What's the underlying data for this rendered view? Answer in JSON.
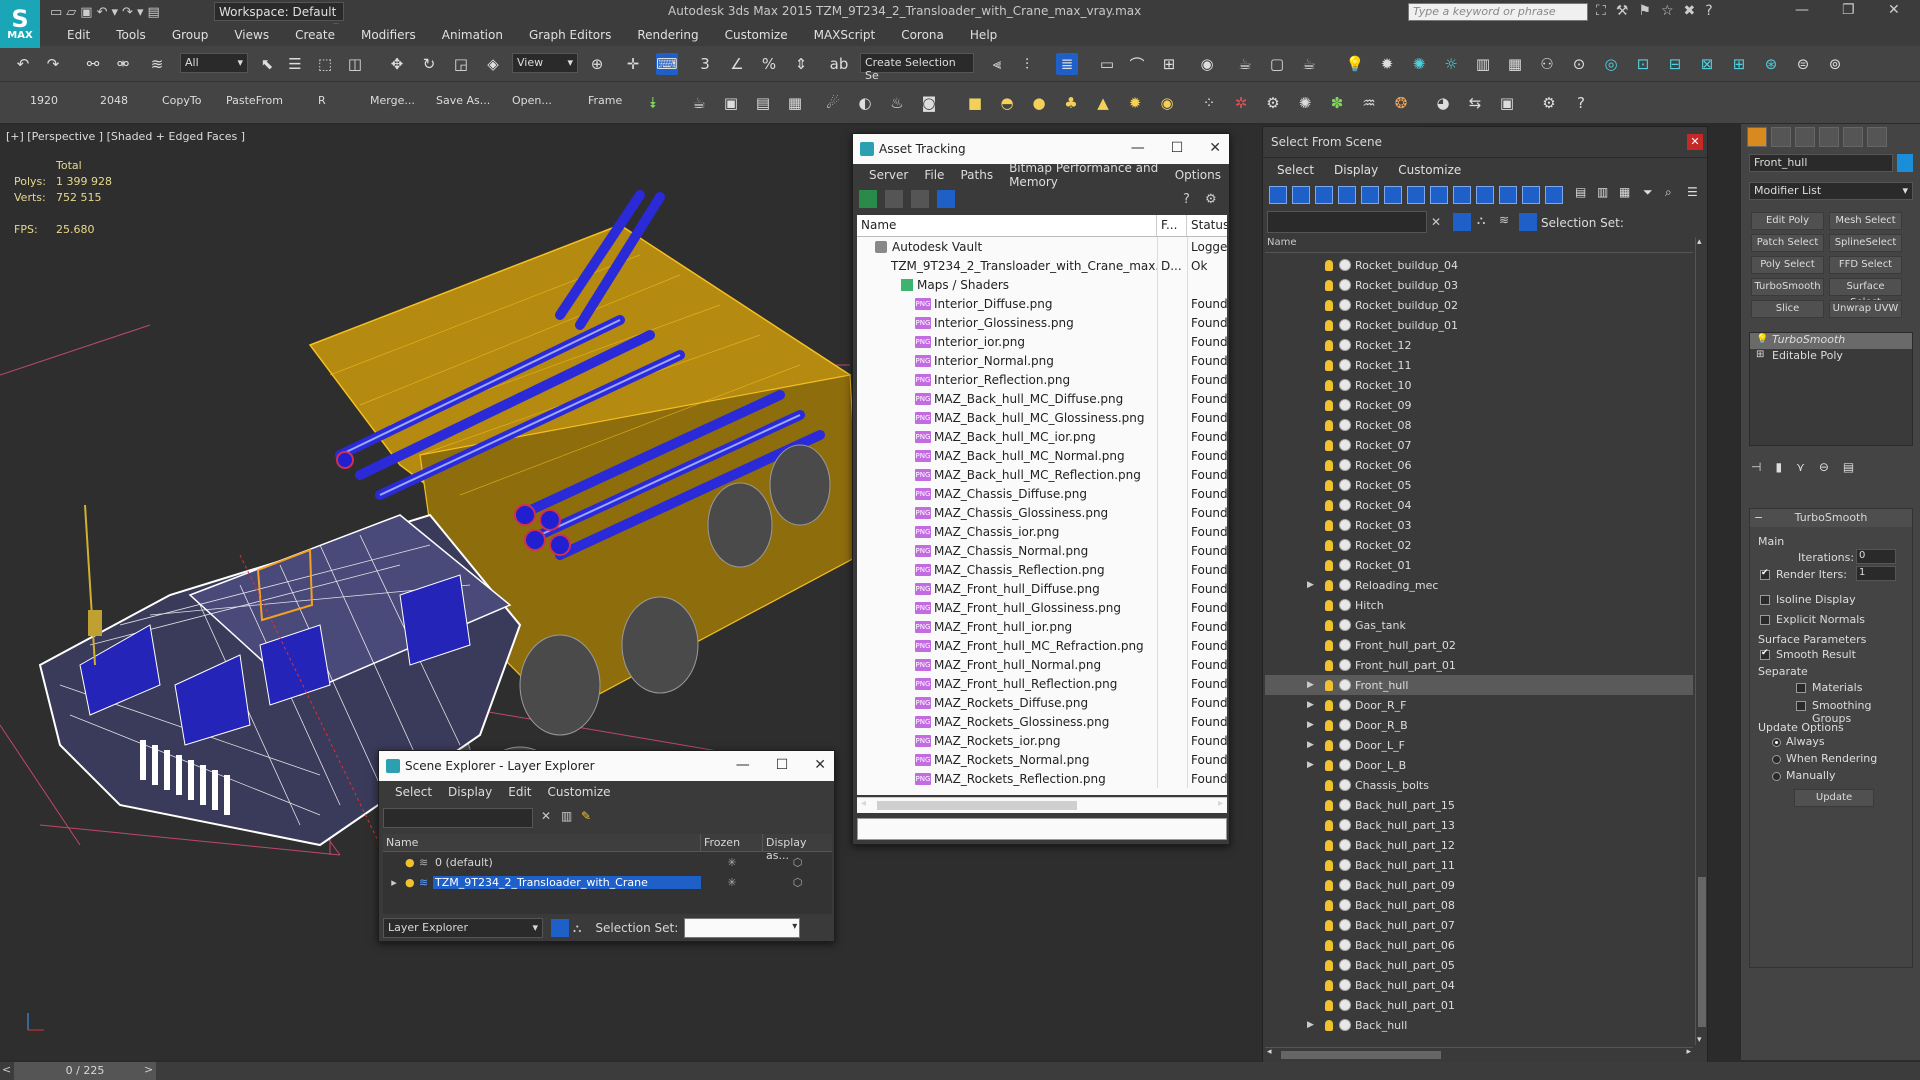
{
  "titlebar": {
    "workspace": "Workspace: Default",
    "title": "Autodesk 3ds Max  2015     TZM_9T234_2_Transloader_with_Crane_max_vray.max",
    "search_placeholder": "Type a keyword or phrase",
    "app_letters": "MAX"
  },
  "menu": [
    "Edit",
    "Tools",
    "Group",
    "Views",
    "Create",
    "Modifiers",
    "Animation",
    "Graph Editors",
    "Rendering",
    "Customize",
    "MAXScript",
    "Corona",
    "Help"
  ],
  "toolbar1": {
    "filter": "All",
    "ref_coord": "View",
    "selection_set": "Create Selection Se"
  },
  "toolbar2": {
    "buttons": [
      "1920",
      "2048",
      "CopyTo",
      "PasteFrom",
      "R",
      "Merge...",
      "Save As...",
      "Open...",
      "Frame"
    ]
  },
  "viewport": {
    "label": "[+] [Perspective ] [Shaded + Edged Faces ]",
    "total_label": "Total",
    "polys_label": "Polys:",
    "polys_value": "1 399 928",
    "verts_label": "Verts:",
    "verts_value": "752 515",
    "fps_label": "FPS:",
    "fps_value": "25.680"
  },
  "asset_tracking": {
    "title": "Asset Tracking",
    "menu": [
      "Server",
      "File",
      "Paths",
      "Bitmap Performance and Memory",
      "Options"
    ],
    "columns": [
      "Name",
      "F...",
      "Status"
    ],
    "rows": [
      {
        "kind": "vault",
        "name": "Autodesk Vault",
        "f": "",
        "status": "Logged"
      },
      {
        "kind": "file",
        "name": "TZM_9T234_2_Transloader_with_Crane_max...",
        "f": "D...",
        "status": "Ok"
      },
      {
        "kind": "maps",
        "name": "Maps / Shaders",
        "f": "",
        "status": ""
      },
      {
        "kind": "png",
        "name": "Interior_Diffuse.png",
        "f": "",
        "status": "Found"
      },
      {
        "kind": "png",
        "name": "Interior_Glossiness.png",
        "f": "",
        "status": "Found"
      },
      {
        "kind": "png",
        "name": "Interior_ior.png",
        "f": "",
        "status": "Found"
      },
      {
        "kind": "png",
        "name": "Interior_Normal.png",
        "f": "",
        "status": "Found"
      },
      {
        "kind": "png",
        "name": "Interior_Reflection.png",
        "f": "",
        "status": "Found"
      },
      {
        "kind": "png",
        "name": "MAZ_Back_hull_MC_Diffuse.png",
        "f": "",
        "status": "Found"
      },
      {
        "kind": "png",
        "name": "MAZ_Back_hull_MC_Glossiness.png",
        "f": "",
        "status": "Found"
      },
      {
        "kind": "png",
        "name": "MAZ_Back_hull_MC_ior.png",
        "f": "",
        "status": "Found"
      },
      {
        "kind": "png",
        "name": "MAZ_Back_hull_MC_Normal.png",
        "f": "",
        "status": "Found"
      },
      {
        "kind": "png",
        "name": "MAZ_Back_hull_MC_Reflection.png",
        "f": "",
        "status": "Found"
      },
      {
        "kind": "png",
        "name": "MAZ_Chassis_Diffuse.png",
        "f": "",
        "status": "Found"
      },
      {
        "kind": "png",
        "name": "MAZ_Chassis_Glossiness.png",
        "f": "",
        "status": "Found"
      },
      {
        "kind": "png",
        "name": "MAZ_Chassis_ior.png",
        "f": "",
        "status": "Found"
      },
      {
        "kind": "png",
        "name": "MAZ_Chassis_Normal.png",
        "f": "",
        "status": "Found"
      },
      {
        "kind": "png",
        "name": "MAZ_Chassis_Reflection.png",
        "f": "",
        "status": "Found"
      },
      {
        "kind": "png",
        "name": "MAZ_Front_hull_Diffuse.png",
        "f": "",
        "status": "Found"
      },
      {
        "kind": "png",
        "name": "MAZ_Front_hull_Glossiness.png",
        "f": "",
        "status": "Found"
      },
      {
        "kind": "png",
        "name": "MAZ_Front_hull_ior.png",
        "f": "",
        "status": "Found"
      },
      {
        "kind": "png",
        "name": "MAZ_Front_hull_MC_Refraction.png",
        "f": "",
        "status": "Found"
      },
      {
        "kind": "png",
        "name": "MAZ_Front_hull_Normal.png",
        "f": "",
        "status": "Found"
      },
      {
        "kind": "png",
        "name": "MAZ_Front_hull_Reflection.png",
        "f": "",
        "status": "Found"
      },
      {
        "kind": "png",
        "name": "MAZ_Rockets_Diffuse.png",
        "f": "",
        "status": "Found"
      },
      {
        "kind": "png",
        "name": "MAZ_Rockets_Glossiness.png",
        "f": "",
        "status": "Found"
      },
      {
        "kind": "png",
        "name": "MAZ_Rockets_ior.png",
        "f": "",
        "status": "Found"
      },
      {
        "kind": "png",
        "name": "MAZ_Rockets_Normal.png",
        "f": "",
        "status": "Found"
      },
      {
        "kind": "png",
        "name": "MAZ_Rockets_Reflection.png",
        "f": "",
        "status": "Found"
      }
    ]
  },
  "scene_explorer": {
    "title": "Scene Explorer - Layer Explorer",
    "menu": [
      "Select",
      "Display",
      "Edit",
      "Customize"
    ],
    "columns": [
      "Name",
      "Frozen",
      "Display as..."
    ],
    "rows": [
      {
        "name": "0 (default)",
        "selected": false
      },
      {
        "name": "TZM_9T234_2_Transloader_with_Crane",
        "selected": true
      }
    ],
    "explorer_type": "Layer Explorer",
    "selection_set_label": "Selection Set:"
  },
  "select_from_scene": {
    "title": "Select From Scene",
    "menu": [
      "Select",
      "Display",
      "Customize"
    ],
    "selection_set_label": "Selection Set:",
    "column_name": "Name",
    "items": [
      {
        "name": "Rocket_buildup_04",
        "expand": false,
        "selected": false
      },
      {
        "name": "Rocket_buildup_03",
        "expand": false,
        "selected": false
      },
      {
        "name": "Rocket_buildup_02",
        "expand": false,
        "selected": false
      },
      {
        "name": "Rocket_buildup_01",
        "expand": false,
        "selected": false
      },
      {
        "name": "Rocket_12",
        "expand": false,
        "selected": false
      },
      {
        "name": "Rocket_11",
        "expand": false,
        "selected": false
      },
      {
        "name": "Rocket_10",
        "expand": false,
        "selected": false
      },
      {
        "name": "Rocket_09",
        "expand": false,
        "selected": false
      },
      {
        "name": "Rocket_08",
        "expand": false,
        "selected": false
      },
      {
        "name": "Rocket_07",
        "expand": false,
        "selected": false
      },
      {
        "name": "Rocket_06",
        "expand": false,
        "selected": false
      },
      {
        "name": "Rocket_05",
        "expand": false,
        "selected": false
      },
      {
        "name": "Rocket_04",
        "expand": false,
        "selected": false
      },
      {
        "name": "Rocket_03",
        "expand": false,
        "selected": false
      },
      {
        "name": "Rocket_02",
        "expand": false,
        "selected": false
      },
      {
        "name": "Rocket_01",
        "expand": false,
        "selected": false
      },
      {
        "name": "Reloading_mec",
        "expand": true,
        "selected": false
      },
      {
        "name": "Hitch",
        "expand": false,
        "selected": false
      },
      {
        "name": "Gas_tank",
        "expand": false,
        "selected": false
      },
      {
        "name": "Front_hull_part_02",
        "expand": false,
        "selected": false
      },
      {
        "name": "Front_hull_part_01",
        "expand": false,
        "selected": false
      },
      {
        "name": "Front_hull",
        "expand": true,
        "selected": true
      },
      {
        "name": "Door_R_F",
        "expand": true,
        "selected": false
      },
      {
        "name": "Door_R_B",
        "expand": true,
        "selected": false
      },
      {
        "name": "Door_L_F",
        "expand": true,
        "selected": false
      },
      {
        "name": "Door_L_B",
        "expand": true,
        "selected": false
      },
      {
        "name": "Chassis_bolts",
        "expand": false,
        "selected": false
      },
      {
        "name": "Back_hull_part_15",
        "expand": false,
        "selected": false
      },
      {
        "name": "Back_hull_part_13",
        "expand": false,
        "selected": false
      },
      {
        "name": "Back_hull_part_12",
        "expand": false,
        "selected": false
      },
      {
        "name": "Back_hull_part_11",
        "expand": false,
        "selected": false
      },
      {
        "name": "Back_hull_part_09",
        "expand": false,
        "selected": false
      },
      {
        "name": "Back_hull_part_08",
        "expand": false,
        "selected": false
      },
      {
        "name": "Back_hull_part_07",
        "expand": false,
        "selected": false
      },
      {
        "name": "Back_hull_part_06",
        "expand": false,
        "selected": false
      },
      {
        "name": "Back_hull_part_05",
        "expand": false,
        "selected": false
      },
      {
        "name": "Back_hull_part_04",
        "expand": false,
        "selected": false
      },
      {
        "name": "Back_hull_part_01",
        "expand": false,
        "selected": false
      },
      {
        "name": "Back_hull",
        "expand": true,
        "selected": false
      }
    ]
  },
  "command_panel": {
    "object_name": "Front_hull",
    "modifier_list": "Modifier List",
    "buttons": [
      "Edit Poly",
      "Mesh Select",
      "Patch Select",
      "SplineSelect",
      "Poly Select",
      "FFD Select",
      "TurboSmooth",
      "Surface Select",
      "Slice",
      "Unwrap UVW"
    ],
    "stack": [
      "TurboSmooth",
      "Editable Poly"
    ],
    "rollout_title": "TurboSmooth",
    "main_label": "Main",
    "iterations_label": "Iterations:",
    "iterations_value": "0",
    "render_iters_label": "Render Iters:",
    "render_iters_value": "1",
    "isoline_label": "Isoline Display",
    "explicit_label": "Explicit Normals",
    "surface_label": "Surface Parameters",
    "smooth_label": "Smooth Result",
    "separate_label": "Separate",
    "materials_label": "Materials",
    "smoothing_label": "Smoothing Groups",
    "update_options_label": "Update Options",
    "always_label": "Always",
    "when_rendering_label": "When Rendering",
    "manually_label": "Manually",
    "update_button": "Update"
  },
  "timeline": {
    "value": "0 / 225"
  },
  "colors": {
    "accent": "#1aa6b7",
    "selection": "#1f5fc8",
    "orange": "#d98a1e"
  }
}
